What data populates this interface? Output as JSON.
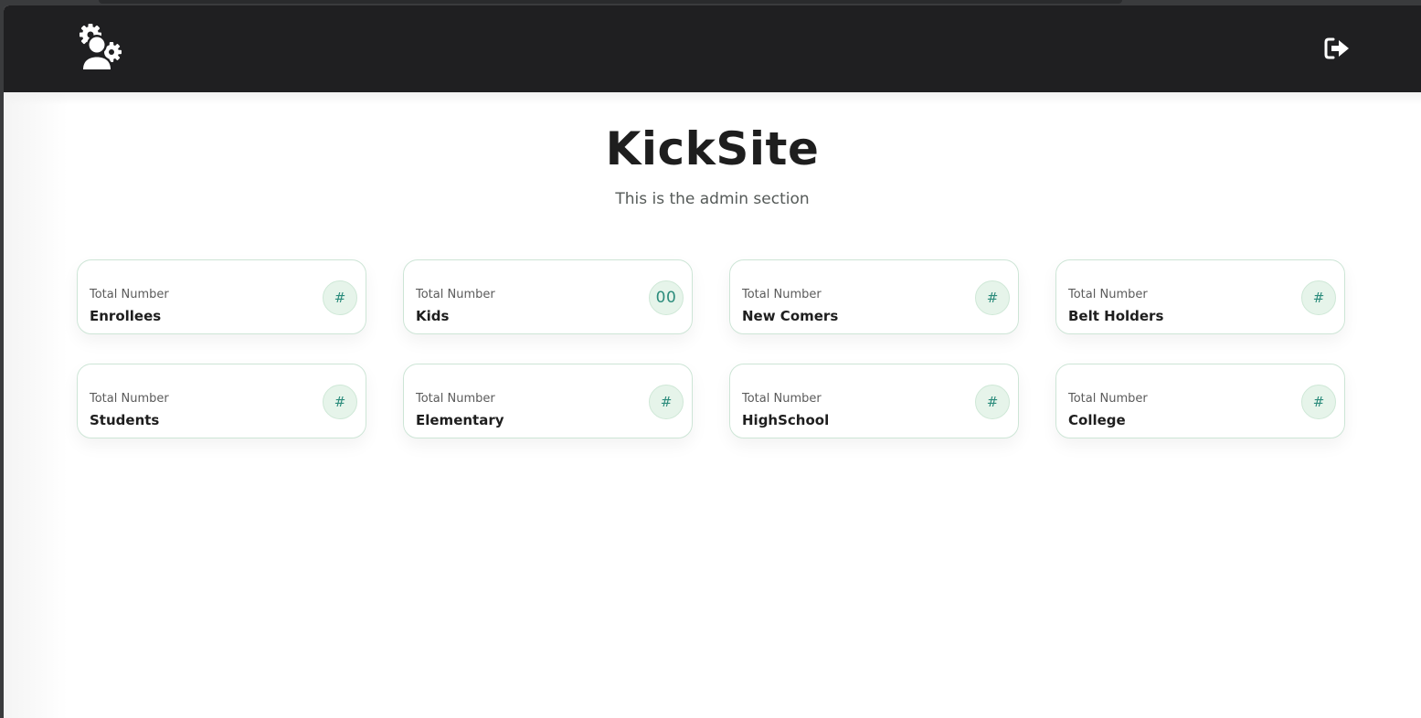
{
  "navbar": {
    "logo_icon": "admin-gear-user-icon",
    "logout_icon": "logout-icon"
  },
  "header": {
    "title": "KickSite",
    "subtitle": "This is the admin section"
  },
  "cards": [
    {
      "label": "Total Number",
      "name": "Enrollees",
      "badge": "#"
    },
    {
      "label": "Total Number",
      "name": "Kids",
      "badge": "00"
    },
    {
      "label": "Total Number",
      "name": "New Comers",
      "badge": "#"
    },
    {
      "label": "Total Number",
      "name": "Belt Holders",
      "badge": "#"
    },
    {
      "label": "Total Number",
      "name": "Students",
      "badge": "#"
    },
    {
      "label": "Total Number",
      "name": "Elementary",
      "badge": "#"
    },
    {
      "label": "Total Number",
      "name": "HighSchool",
      "badge": "#"
    },
    {
      "label": "Total Number",
      "name": "College",
      "badge": "#"
    }
  ],
  "colors": {
    "navbar": "#1f1f21",
    "card_border": "#cde5d6",
    "badge_bg": "#e6f4ea",
    "badge_text": "#2c8c7c"
  }
}
